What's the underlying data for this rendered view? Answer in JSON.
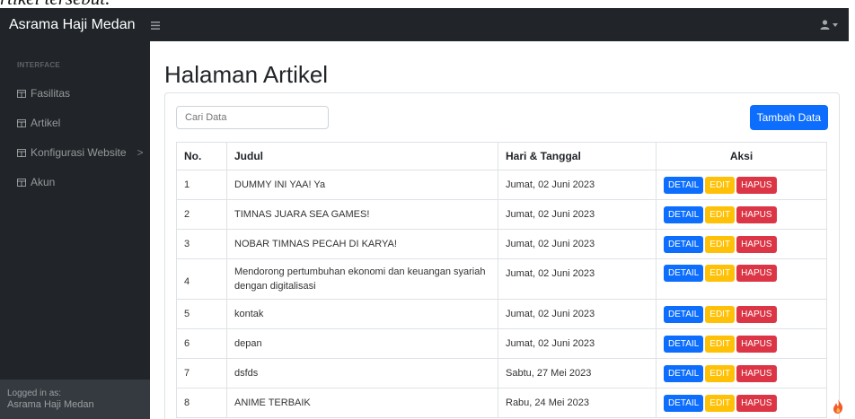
{
  "clipped_heading": "rtikel tersebut.",
  "navbar": {
    "brand": "Asrama Haji Medan",
    "toggle_icon": "bars-icon",
    "user_icon": "user-icon"
  },
  "sidebar": {
    "heading": "INTERFACE",
    "items": [
      {
        "label": "Fasilitas",
        "icon": "table-icon"
      },
      {
        "label": "Artikel",
        "icon": "table-icon"
      },
      {
        "label": "Konfigurasi Website",
        "icon": "table-icon",
        "chevron": ">"
      },
      {
        "label": "Akun",
        "icon": "table-icon"
      }
    ],
    "footer": {
      "caption": "Logged in as:",
      "user": "Asrama Haji Medan"
    }
  },
  "main": {
    "title": "Halaman Artikel",
    "search_placeholder": "Cari Data",
    "add_button": "Tambah Data",
    "table": {
      "headers": [
        "No.",
        "Judul",
        "Hari & Tanggal",
        "Aksi"
      ],
      "action_labels": {
        "detail": "DETAIL",
        "edit": "EDIT",
        "hapus": "HAPUS"
      },
      "rows": [
        {
          "no": "1",
          "judul": "DUMMY INI YAA! Ya",
          "tanggal": "Jumat, 02 Juni 2023"
        },
        {
          "no": "2",
          "judul": "TIMNAS JUARA SEA GAMES!",
          "tanggal": "Jumat, 02 Juni 2023"
        },
        {
          "no": "3",
          "judul": "NOBAR TIMNAS PECAH DI KARYA!",
          "tanggal": "Jumat, 02 Juni 2023"
        },
        {
          "no": "4",
          "judul": "Mendorong pertumbuhan ekonomi dan keuangan syariah dengan digitalisasi",
          "tanggal": "Jumat, 02 Juni 2023"
        },
        {
          "no": "5",
          "judul": "kontak",
          "tanggal": "Jumat, 02 Juni 2023"
        },
        {
          "no": "6",
          "judul": "depan",
          "tanggal": "Jumat, 02 Juni 2023"
        },
        {
          "no": "7",
          "judul": "dsfds",
          "tanggal": "Sabtu, 27 Mei 2023"
        },
        {
          "no": "8",
          "judul": "ANIME TERBAIK",
          "tanggal": "Rabu, 24 Mei 2023"
        }
      ]
    }
  },
  "colors": {
    "sidebar": "#212529",
    "primary": "#0d6efd",
    "warning": "#ffc107",
    "danger": "#dc3545"
  }
}
